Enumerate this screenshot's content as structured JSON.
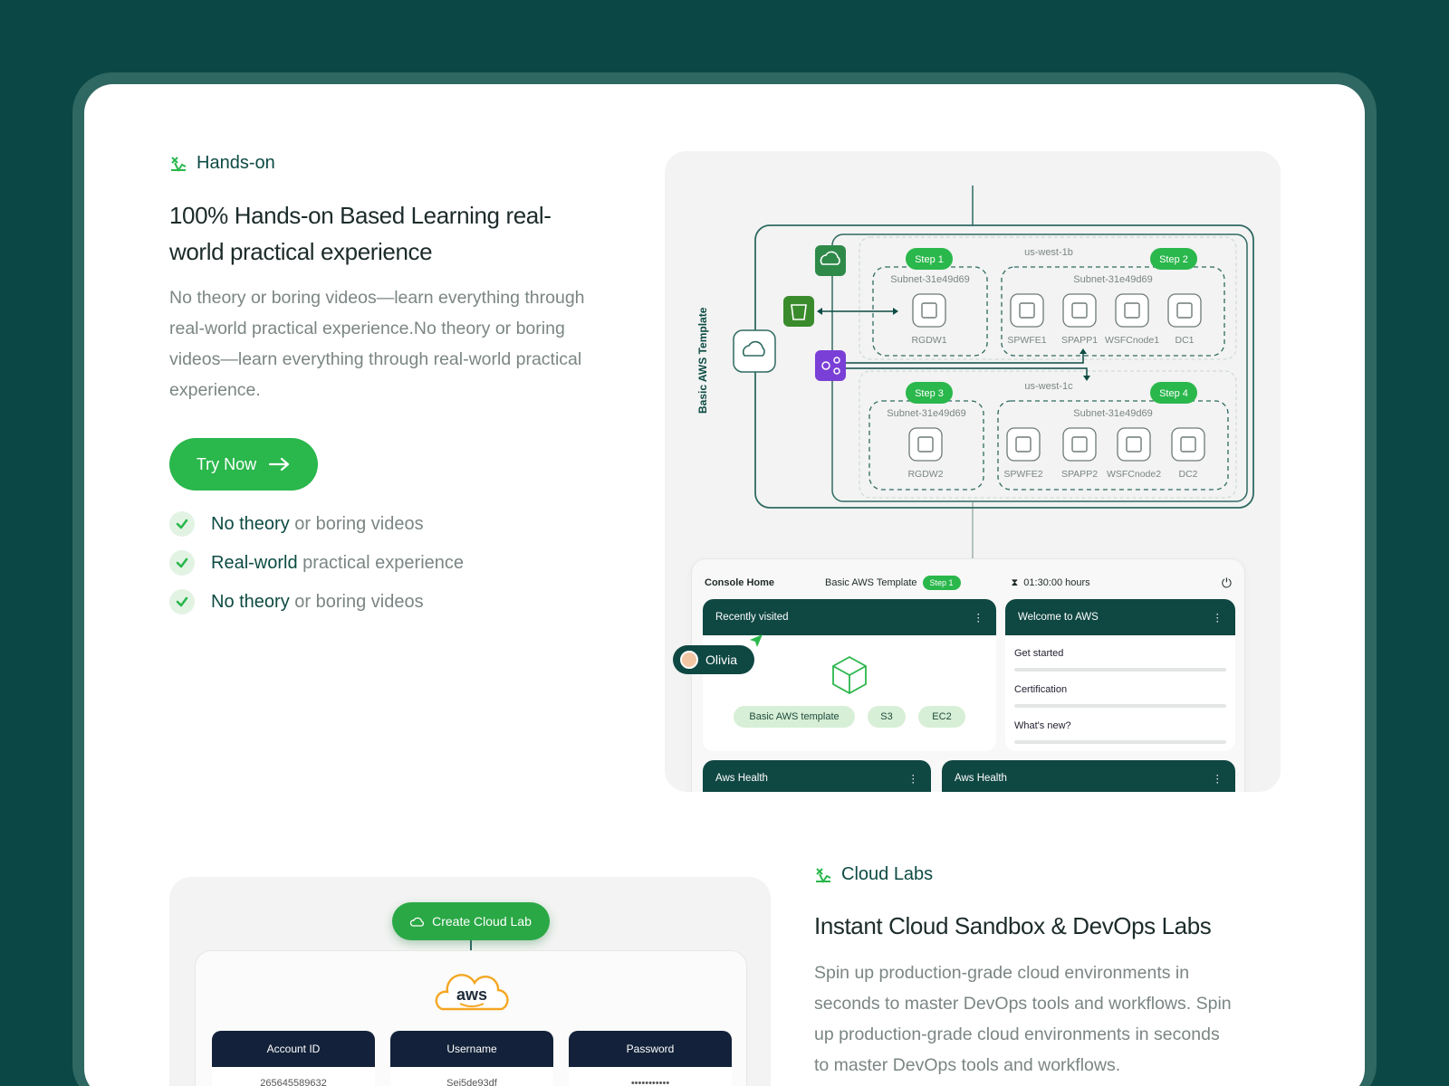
{
  "hands_on": {
    "eyebrow": "Hands-on",
    "title_line1": "100% Hands-on Based Learning real-",
    "title_line2": "world practical experience",
    "para_line1": "No theory or boring videos—learn everything through",
    "para_line2": "real-world practical experience.No theory or boring",
    "para_line3": "videos—learn everything through real-world practical",
    "para_line4": "experience.",
    "cta_label": "Try Now",
    "features": [
      {
        "strong": "No theory",
        "rest": " or boring videos"
      },
      {
        "strong": "Real-world",
        "rest": " practical experience"
      },
      {
        "strong": "No theory",
        "rest": " or boring videos"
      }
    ]
  },
  "diagram": {
    "template_label": "Basic AWS Template",
    "zone_b": "us-west-1b",
    "zone_c": "us-west-1c",
    "steps": [
      "Step 1",
      "Step 2",
      "Step 3",
      "Step 4"
    ],
    "subnet": "Subnet-31e49d69",
    "row1_nodes": [
      "RGDW1",
      "SPWFE1",
      "SPAPP1",
      "WSFCnode1",
      "DC1"
    ],
    "row2_nodes": [
      "RGDW2",
      "SPWFE2",
      "SPAPP2",
      "WSFCnode2",
      "DC2"
    ]
  },
  "console": {
    "home": "Console Home",
    "template": "Basic AWS Template",
    "step": "Step 1",
    "timer": "01:30:00 hours",
    "recent_title": "Recently visited",
    "tags": [
      "Basic AWS template",
      "S3",
      "EC2"
    ],
    "welcome_title": "Welcome to AWS",
    "links": [
      "Get started",
      "Certification",
      "What's new?"
    ],
    "health1": "Aws Health",
    "health2": "Aws Health",
    "user": "Olivia"
  },
  "lab": {
    "create_label": "Create Cloud Lab",
    "aws_logo": "aws",
    "cols": [
      {
        "head": "Account ID",
        "value": "265645589632"
      },
      {
        "head": "Username",
        "value": "Sei5de93df"
      },
      {
        "head": "Password",
        "value": "•••••••••••"
      }
    ]
  },
  "cloud_labs": {
    "eyebrow": "Cloud Labs",
    "title": "Instant Cloud Sandbox & DevOps Labs",
    "para_line1": "Spin up production-grade cloud environments in",
    "para_line2": "seconds to master DevOps tools and workflows. Spin",
    "para_line3": "up production-grade cloud environments in seconds",
    "para_line4": "to master DevOps tools and workflows."
  },
  "colors": {
    "accent_green": "#2ab74c",
    "dark_teal": "#0b4744",
    "text_dark": "#1c2b2a",
    "text_muted": "#7b8684"
  }
}
